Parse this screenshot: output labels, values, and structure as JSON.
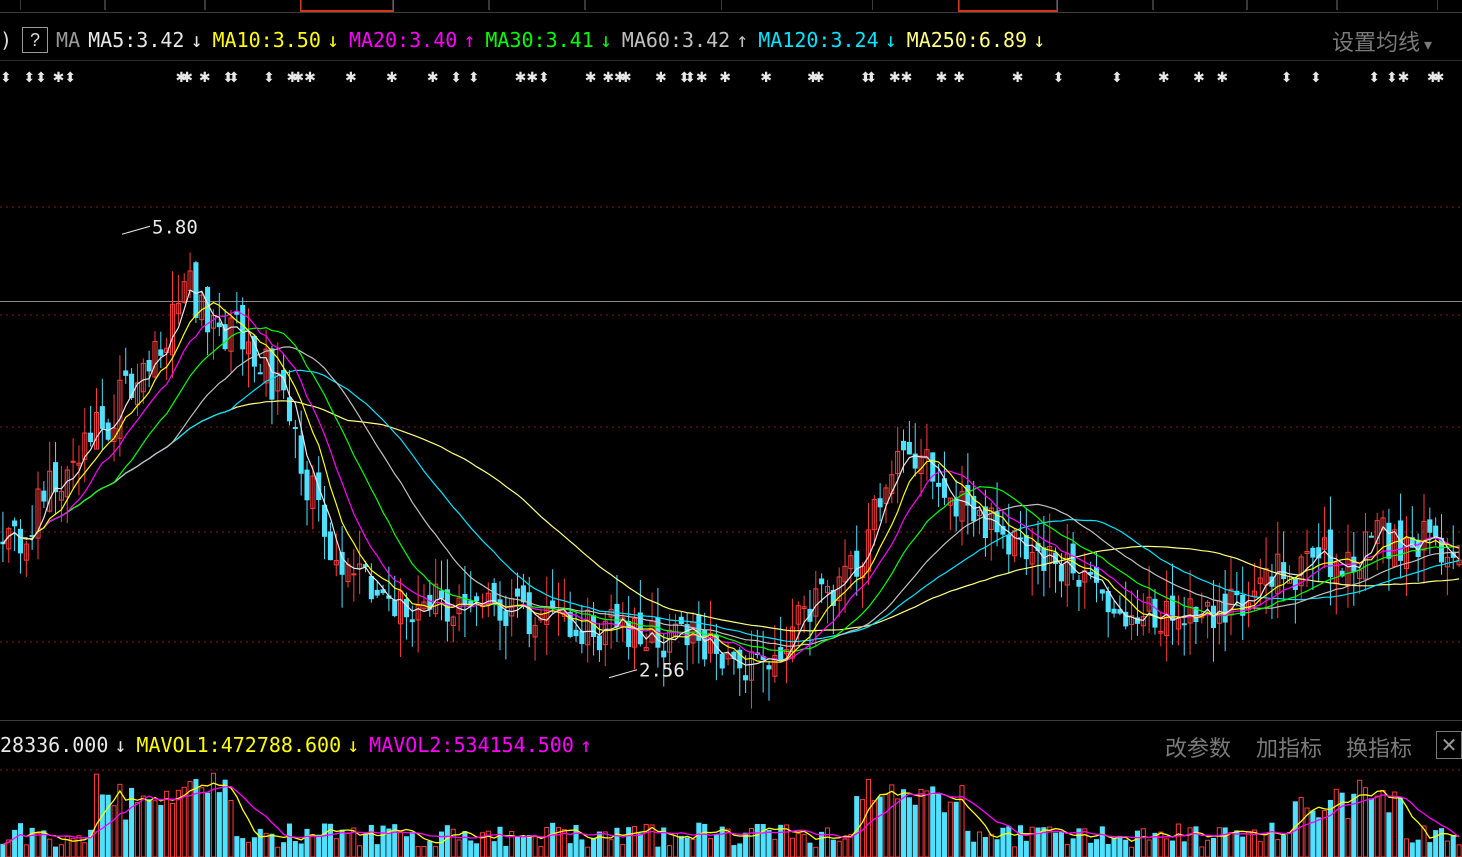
{
  "ma_legend": {
    "paren": ")",
    "help": "?",
    "label": "MA",
    "items": [
      {
        "text": "MA5:3.42",
        "arrow": "↓",
        "color": "#e8e8e8"
      },
      {
        "text": "MA10:3.50",
        "arrow": "↓",
        "color": "#ffff00"
      },
      {
        "text": "MA20:3.40",
        "arrow": "↑",
        "color": "#ff00ff"
      },
      {
        "text": "MA30:3.41",
        "arrow": "↓",
        "color": "#00ff00"
      },
      {
        "text": "MA60:3.42",
        "arrow": "↑",
        "color": "#c0c0c0"
      },
      {
        "text": "MA120:3.24",
        "arrow": "↓",
        "color": "#00e5ff"
      },
      {
        "text": "MA250:6.89",
        "arrow": "↓",
        "color": "#ffff80"
      }
    ],
    "settings_label": "设置均线",
    "settings_caret": "▾"
  },
  "vol_legend": {
    "items": [
      {
        "text": "28336.000",
        "arrow": "↓",
        "color": "#e8e8e8"
      },
      {
        "text": "MAVOL1:472788.600",
        "arrow": "↓",
        "color": "#ffff00"
      },
      {
        "text": "MAVOL2:534154.500",
        "arrow": "↑",
        "color": "#ff00ff"
      }
    ],
    "buttons": {
      "change_params": "改参数",
      "add_indicator": "加指标",
      "switch_indicator": "换指标",
      "close": "✕"
    }
  },
  "colors": {
    "up": "#ff3b3b",
    "down": "#4fe1ff",
    "ma5": "#e8e8e8",
    "ma10": "#ffff00",
    "ma20": "#ff00ff",
    "ma30": "#00ff00",
    "ma60": "#c0c0c0",
    "ma120": "#00e5ff",
    "ma250": "#ffff80",
    "grid": "#8a1c1c"
  },
  "chart_data": {
    "type": "candlestick",
    "ylim": [
      2.2,
      7.0
    ],
    "reference_price": 5.25,
    "annotations": [
      {
        "text": "5.80",
        "price": 5.8,
        "marker": "high"
      },
      {
        "text": "2.56",
        "price": 2.56,
        "marker": "low"
      }
    ],
    "volume_ylim": [
      0,
      2000000
    ]
  }
}
